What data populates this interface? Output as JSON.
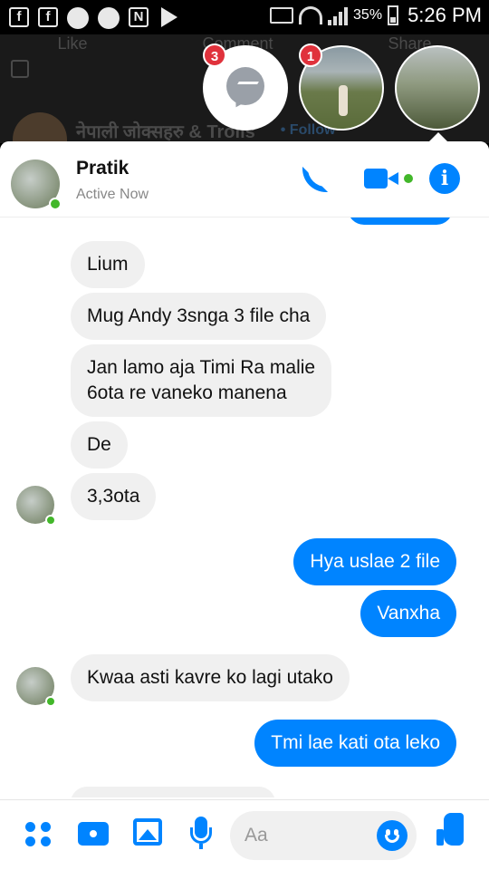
{
  "status_bar": {
    "left_icons": [
      "f",
      "f",
      "messenger",
      "messenger",
      "N",
      "play"
    ],
    "battery_pct": "35%",
    "time": "5:26 PM"
  },
  "background": {
    "actions": [
      "Like",
      "Comment",
      "Share"
    ],
    "page_name": "नेपाली जोक्सहरु & Trolls",
    "follow_label": "• Follow"
  },
  "chat_heads": [
    {
      "kind": "messenger-icon",
      "badge": "3"
    },
    {
      "kind": "photo",
      "badge": "1"
    },
    {
      "kind": "photo",
      "badge": ""
    }
  ],
  "header": {
    "name": "Pratik",
    "status": "Active Now",
    "accent": "#0084ff",
    "online_color": "#42b72a"
  },
  "messages": [
    {
      "from": "them",
      "text": "Lium"
    },
    {
      "from": "them",
      "text": "Mug Andy 3snga 3 file cha"
    },
    {
      "from": "them",
      "lines": [
        "Jan lamo aja Timi  Ra malie",
        "6ota re vaneko manena"
      ]
    },
    {
      "from": "them",
      "text": "De"
    },
    {
      "from": "them",
      "text": "3,3ota",
      "avatar": true
    },
    {
      "from": "me",
      "text": "Hya uslae 2 file"
    },
    {
      "from": "me",
      "text": "Vanxha"
    },
    {
      "from": "them",
      "text": "Kwaa asti kavre ko lagi utako",
      "avatar": true
    },
    {
      "from": "me",
      "text": "Tmi lae kati ota leko"
    }
  ],
  "composer": {
    "placeholder": "Aa",
    "icons": [
      "more-icon",
      "camera-icon",
      "gallery-icon",
      "microphone-icon",
      "emoji-icon",
      "thumbs-up-icon"
    ]
  }
}
